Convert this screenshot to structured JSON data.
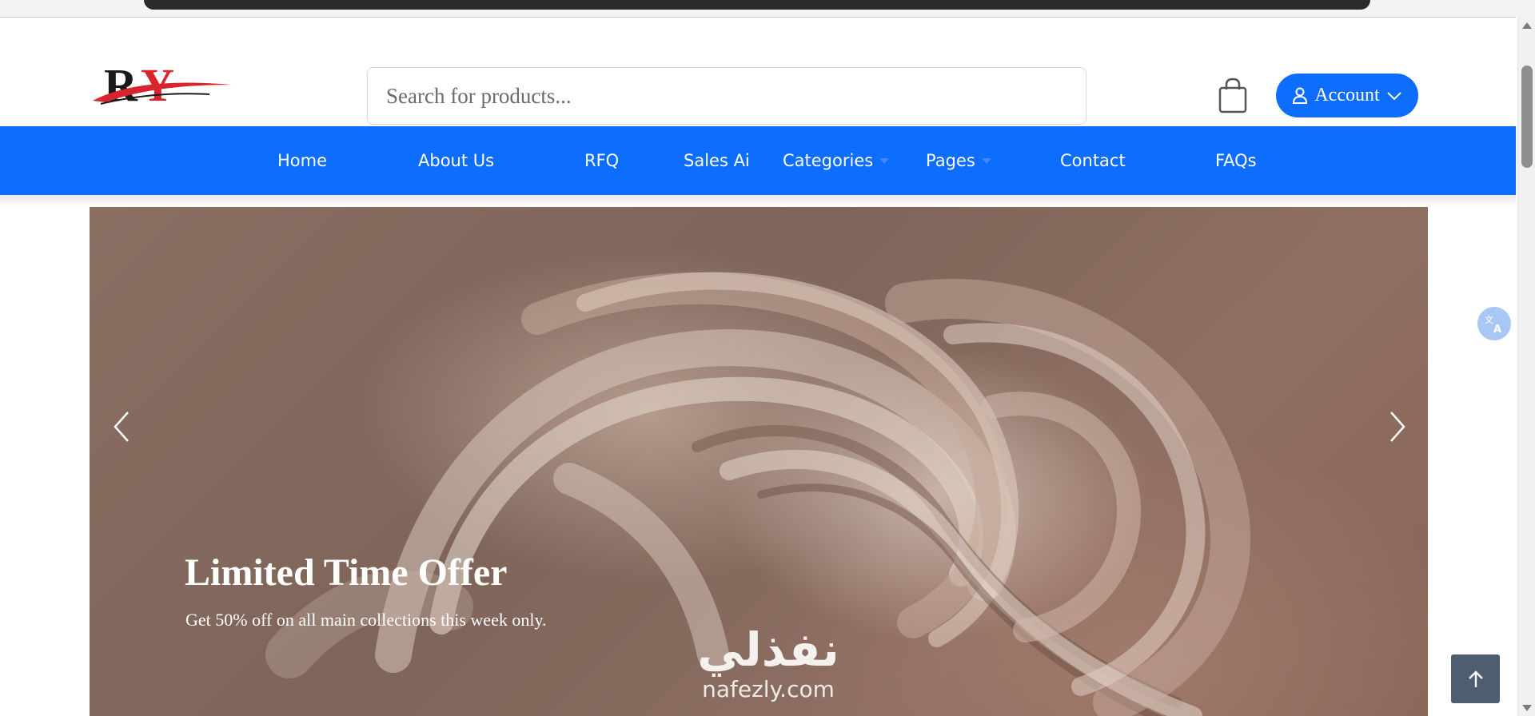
{
  "header": {
    "logo_text": "RY",
    "search": {
      "placeholder": "Search for products...",
      "value": ""
    },
    "cart_icon": "shopping-bag-icon",
    "account_label": "Account"
  },
  "nav": {
    "items": [
      {
        "label": "Home",
        "has_dropdown": false
      },
      {
        "label": "About Us",
        "has_dropdown": false
      },
      {
        "label": "RFQ",
        "has_dropdown": false
      },
      {
        "label": "Sales Ai",
        "has_dropdown": false
      },
      {
        "label": "Categories",
        "has_dropdown": true
      },
      {
        "label": "Pages",
        "has_dropdown": true
      },
      {
        "label": "Contact",
        "has_dropdown": false
      },
      {
        "label": "FAQs",
        "has_dropdown": false
      }
    ]
  },
  "hero": {
    "title": "Limited Time Offer",
    "subtitle": "Get 50% off on all main collections this week only."
  },
  "watermark": {
    "arabic": "نفذلي",
    "latin": "nafezly.com"
  },
  "colors": {
    "primary": "#0d6efd",
    "nav_text": "#ffffff",
    "back_to_top_bg": "#4f5d73",
    "logo_red": "#d9232d",
    "logo_black": "#1a1a1a"
  }
}
